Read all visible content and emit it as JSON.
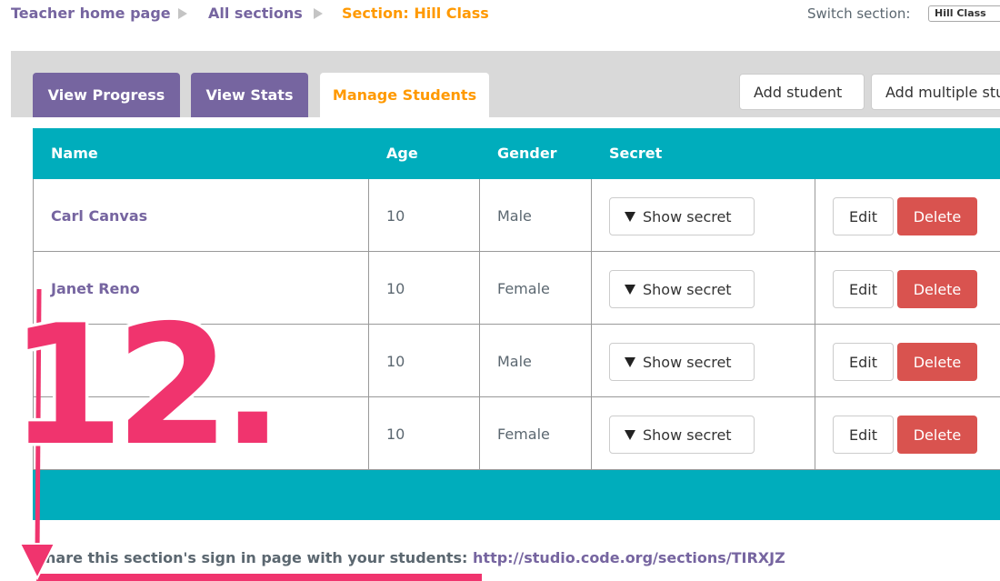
{
  "breadcrumb": {
    "home": "Teacher home page",
    "sections": "All sections",
    "current": "Section: Hill Class"
  },
  "switch_section": {
    "label": "Switch section:",
    "selected": "Hill Class"
  },
  "tabs": [
    {
      "label": "View Progress"
    },
    {
      "label": "View Stats"
    },
    {
      "label": "Manage Students"
    }
  ],
  "actions": {
    "add_student": "Add student",
    "add_multiple": "Add multiple students"
  },
  "table": {
    "headers": {
      "name": "Name",
      "age": "Age",
      "gender": "Gender",
      "secret": "Secret"
    },
    "rows": [
      {
        "name": "Carl Canvas",
        "age": "10",
        "gender": "Male"
      },
      {
        "name": "Janet Reno",
        "age": "10",
        "gender": "Female"
      },
      {
        "name": "",
        "age": "10",
        "gender": "Male"
      },
      {
        "name": "",
        "age": "10",
        "gender": "Female"
      }
    ],
    "show_secret": "Show secret",
    "edit": "Edit",
    "delete": "Delete"
  },
  "share": {
    "text": "hare this section's sign in page with your students: ",
    "link": "http://studio.code.org/sections/TIRXJZ"
  },
  "overlay": {
    "step_number": "12.",
    "accent_color": "#f0346e"
  },
  "colors": {
    "purple": "#7665a0",
    "orange": "#ff9900",
    "teal": "#00adbc",
    "red": "#d9534f"
  }
}
